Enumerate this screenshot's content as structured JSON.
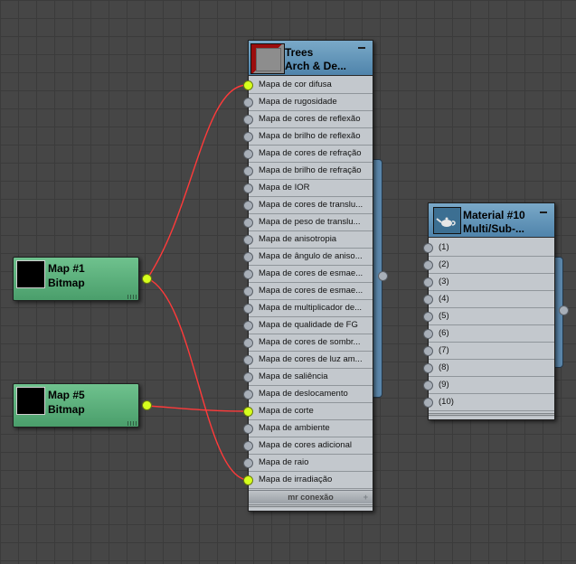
{
  "nodes": {
    "trees": {
      "title_line1": "Trees",
      "title_line2": "Arch & De...",
      "slots": [
        {
          "label": "Mapa de cor difusa",
          "connected": true
        },
        {
          "label": "Mapa de rugosidade",
          "connected": false
        },
        {
          "label": "Mapa de cores de reflexão",
          "connected": false
        },
        {
          "label": "Mapa de brilho de reflexão",
          "connected": false
        },
        {
          "label": "Mapa de cores de refração",
          "connected": false
        },
        {
          "label": "Mapa de brilho de refração",
          "connected": false
        },
        {
          "label": "Mapa de IOR",
          "connected": false
        },
        {
          "label": "Mapa de cores de translu...",
          "connected": false
        },
        {
          "label": "Mapa de peso de translu...",
          "connected": false
        },
        {
          "label": "Mapa de anisotropia",
          "connected": false
        },
        {
          "label": "Mapa de ângulo de aniso...",
          "connected": false
        },
        {
          "label": "Mapa de cores de esmae...",
          "connected": false
        },
        {
          "label": "Mapa de cores de esmae...",
          "connected": false
        },
        {
          "label": "Mapa de multiplicador de...",
          "connected": false
        },
        {
          "label": "Mapa de qualidade de FG",
          "connected": false
        },
        {
          "label": "Mapa de cores de sombr...",
          "connected": false
        },
        {
          "label": "Mapa de cores de luz am...",
          "connected": false
        },
        {
          "label": "Mapa de saliência",
          "connected": false
        },
        {
          "label": "Mapa de deslocamento",
          "connected": false
        },
        {
          "label": "Mapa de corte",
          "connected": true
        },
        {
          "label": "Mapa de ambiente",
          "connected": false
        },
        {
          "label": "Mapa de cores adicional",
          "connected": false
        },
        {
          "label": "Mapa de raio",
          "connected": false
        },
        {
          "label": "Mapa de irradiação",
          "connected": true
        }
      ],
      "footer": "mr conexão"
    },
    "material10": {
      "title_line1": "Material #10",
      "title_line2": "Multi/Sub-...",
      "slots": [
        "(1)",
        "(2)",
        "(3)",
        "(4)",
        "(5)",
        "(6)",
        "(7)",
        "(8)",
        "(9)",
        "(10)"
      ]
    },
    "map1": {
      "title_line1": "Map #1",
      "title_line2": "Bitmap"
    },
    "map5": {
      "title_line1": "Map #5",
      "title_line2": "Bitmap"
    }
  },
  "colors": {
    "canvas": "#464646",
    "material_header": "#5b8db2",
    "bitmap_node": "#5db07c",
    "wire": "#ff3a3a",
    "port_active": "#d6ff1d",
    "port_idle": "#a8afb8",
    "trees_swatch_accent": "#9b0d0d"
  },
  "icons": {
    "trees_swatch": "material-preview-swatch",
    "material10_swatch": "teapot-icon",
    "collapse": "minus-icon",
    "footer_expand": "plus-icon"
  }
}
